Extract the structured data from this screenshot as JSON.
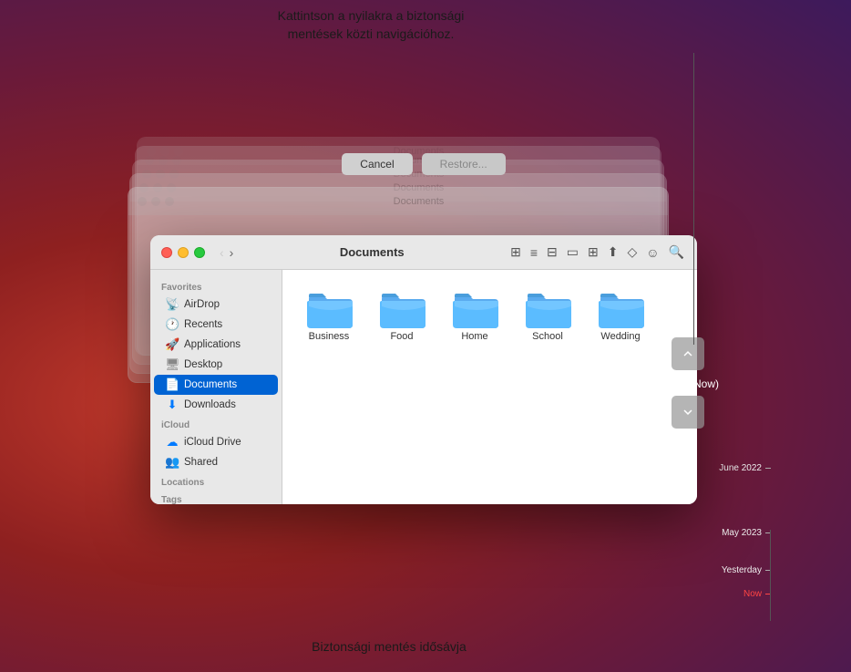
{
  "annotation": {
    "top_line1": "Kattintson a nyilakra a biztonsági",
    "top_line2": "mentések közti navigációhoz.",
    "bottom": "Biztonsági mentés idősávja"
  },
  "finder": {
    "title": "Documents",
    "sidebar": {
      "favorites_label": "Favorites",
      "items_favorites": [
        {
          "label": "AirDrop",
          "icon": "📡"
        },
        {
          "label": "Recents",
          "icon": "🕐"
        },
        {
          "label": "Applications",
          "icon": "🚀"
        },
        {
          "label": "Desktop",
          "icon": "🖥"
        },
        {
          "label": "Documents",
          "icon": "📄",
          "active": true
        },
        {
          "label": "Downloads",
          "icon": "⬇"
        }
      ],
      "icloud_label": "iCloud",
      "items_icloud": [
        {
          "label": "iCloud Drive",
          "icon": "☁"
        },
        {
          "label": "Shared",
          "icon": "👥"
        }
      ],
      "locations_label": "Locations",
      "tags_label": "Tags"
    },
    "folders": [
      {
        "name": "Business"
      },
      {
        "name": "Food"
      },
      {
        "name": "Home"
      },
      {
        "name": "School"
      },
      {
        "name": "Wedding"
      }
    ]
  },
  "buttons": {
    "cancel": "Cancel",
    "restore": "Restore..."
  },
  "timeline": {
    "today_label": "Today (Now)",
    "entries": [
      {
        "label": "June 2022",
        "color": "normal"
      },
      {
        "label": "May 2023",
        "color": "normal"
      },
      {
        "label": "Yesterday",
        "color": "normal"
      },
      {
        "label": "Now",
        "color": "red"
      }
    ]
  },
  "ghost_title": "Documents"
}
